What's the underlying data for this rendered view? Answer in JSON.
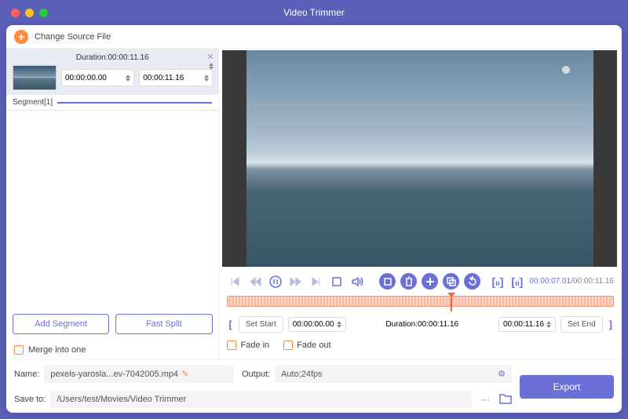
{
  "app_title": "Video Trimmer",
  "topbar": {
    "change_source": "Change Source File"
  },
  "segment": {
    "duration_label": "Duration:00:00:11.16",
    "start": "00:00:00.00",
    "end": "00:00:11.16",
    "name": "Segment[1]"
  },
  "buttons": {
    "add_segment": "Add Segment",
    "fast_split": "Fast Split",
    "set_start": "Set Start",
    "set_end": "Set End",
    "export": "Export"
  },
  "options": {
    "merge": "Merge into one",
    "fade_in": "Fade in",
    "fade_out": "Fade out"
  },
  "playback": {
    "current": "00:00:07.01",
    "total": "/00:00:11.16"
  },
  "range": {
    "start": "00:00:00.00",
    "duration_label": "Duration:00:00:11.16",
    "end": "00:00:11.16"
  },
  "output": {
    "name_label": "Name:",
    "filename": "pexels-yarosla...ev-7042005.mp4",
    "output_label": "Output:",
    "output_value": "Auto;24fps",
    "save_label": "Save to:",
    "save_path": "/Users/test/Movies/Video Trimmer"
  }
}
